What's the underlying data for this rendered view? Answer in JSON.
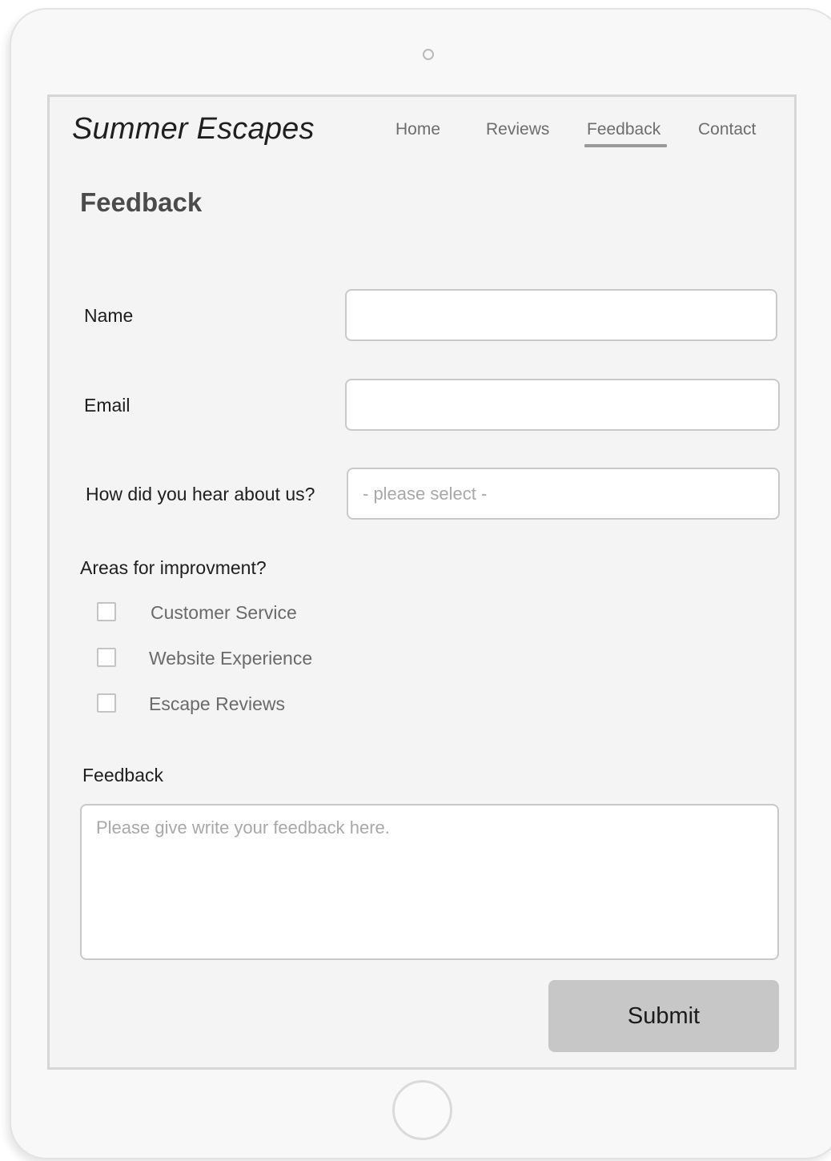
{
  "app": {
    "logo": "Summer Escapes"
  },
  "nav": {
    "items": [
      {
        "label": "Home"
      },
      {
        "label": "Reviews"
      },
      {
        "label": "Feedback",
        "active": true
      },
      {
        "label": "Contact"
      }
    ]
  },
  "page": {
    "title": "Feedback"
  },
  "form": {
    "name_label": "Name",
    "name_value": "",
    "email_label": "Email",
    "email_value": "",
    "hear_label": "How did you hear about us?",
    "hear_selected": "- please select -",
    "areas_label": "Areas for improvment?",
    "areas_options": [
      {
        "label": "Customer Service",
        "checked": false
      },
      {
        "label": "Website Experience",
        "checked": false
      },
      {
        "label": "Escape Reviews",
        "checked": false
      }
    ],
    "feedback_label": "Feedback",
    "feedback_placeholder": "Please give write your feedback here.",
    "submit_label": "Submit"
  },
  "colors": {
    "screen_bg": "#f4f4f4",
    "device_bg": "#f8f8f8",
    "button_bg": "#c7c7c7",
    "nav_active_underline": "#9a9a9a",
    "placeholder_text": "#a8a8a8"
  }
}
